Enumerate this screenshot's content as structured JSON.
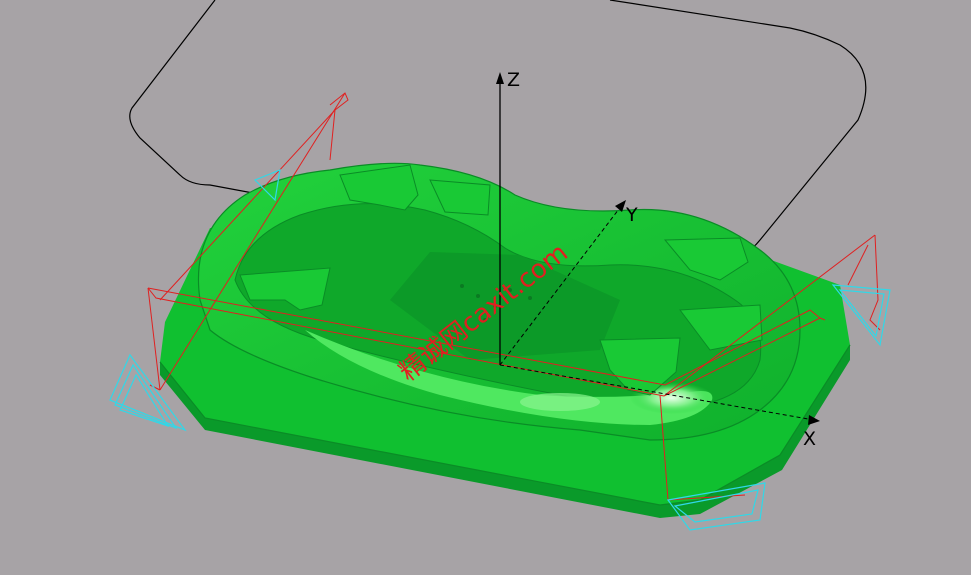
{
  "axes": {
    "x_label": "X",
    "y_label": "Y",
    "z_label": "Z"
  },
  "watermark": "精诚网caxit.com",
  "colors": {
    "background": "#a7a3a6",
    "part_green": "#10c030",
    "part_green_dark": "#0a8c26",
    "part_green_light": "#5cf070",
    "highlight": "#aaffaa",
    "toolpath_red": "#e02020",
    "toolpath_cyan": "#30d8e8",
    "boundary_black": "#000000"
  }
}
